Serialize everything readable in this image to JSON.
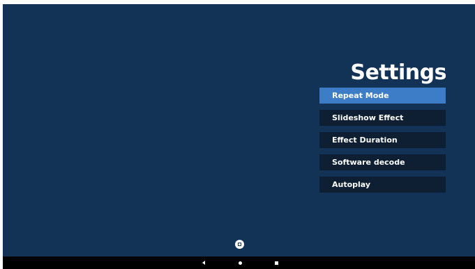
{
  "screen": {
    "background_color": "#123256"
  },
  "settings": {
    "title": "Settings",
    "items": [
      {
        "label": "Repeat Mode",
        "selected": true
      },
      {
        "label": "Slideshow Effect",
        "selected": false
      },
      {
        "label": "Effect Duration",
        "selected": false
      },
      {
        "label": "Software decode",
        "selected": false
      },
      {
        "label": "Autoplay",
        "selected": false
      }
    ],
    "selected_color": "#3d7cc6",
    "item_color": "#0e1f33"
  },
  "floating_button": {
    "icon": "square-in-circle-icon"
  },
  "nav_bar": {
    "back_icon": "back-triangle-icon",
    "home_icon": "home-circle-icon",
    "recent_icon": "recent-apps-square-icon"
  }
}
